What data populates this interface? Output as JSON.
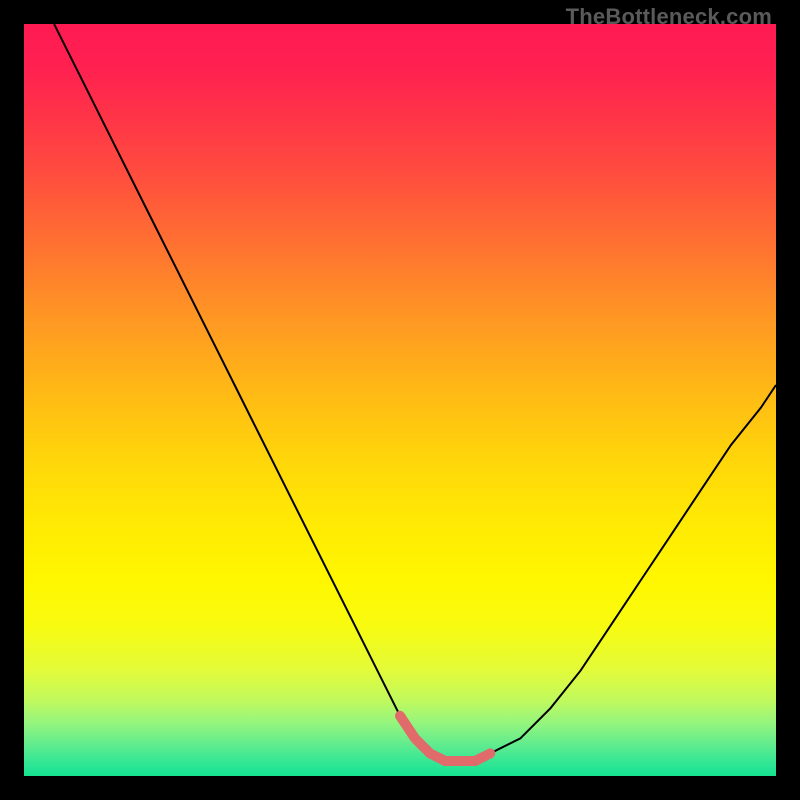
{
  "watermark": "TheBottleneck.com",
  "gradient": {
    "stops": [
      {
        "offset": 0.0,
        "color": "#ff1a52"
      },
      {
        "offset": 0.06,
        "color": "#ff2150"
      },
      {
        "offset": 0.12,
        "color": "#ff3348"
      },
      {
        "offset": 0.2,
        "color": "#ff4d3e"
      },
      {
        "offset": 0.3,
        "color": "#ff7430"
      },
      {
        "offset": 0.4,
        "color": "#ff9a22"
      },
      {
        "offset": 0.5,
        "color": "#ffbd14"
      },
      {
        "offset": 0.58,
        "color": "#ffd60a"
      },
      {
        "offset": 0.66,
        "color": "#ffe904"
      },
      {
        "offset": 0.74,
        "color": "#fff700"
      },
      {
        "offset": 0.8,
        "color": "#f8fb10"
      },
      {
        "offset": 0.86,
        "color": "#e2fb3a"
      },
      {
        "offset": 0.9,
        "color": "#c0f95e"
      },
      {
        "offset": 0.93,
        "color": "#94f57e"
      },
      {
        "offset": 0.96,
        "color": "#5deb8f"
      },
      {
        "offset": 0.985,
        "color": "#2de695"
      },
      {
        "offset": 1.0,
        "color": "#16e28f"
      }
    ]
  },
  "chart_data": {
    "type": "line",
    "title": "",
    "xlabel": "",
    "ylabel": "",
    "xlim": [
      0,
      100
    ],
    "ylim": [
      0,
      100
    ],
    "series": [
      {
        "name": "curve",
        "x": [
          4,
          8,
          12,
          16,
          20,
          24,
          28,
          32,
          36,
          40,
          44,
          48,
          50,
          52,
          54,
          56,
          58,
          60,
          62,
          66,
          70,
          74,
          78,
          82,
          86,
          90,
          94,
          98,
          100
        ],
        "y": [
          100,
          92,
          84,
          76,
          68,
          60,
          52,
          44,
          36,
          28,
          20,
          12,
          8,
          5,
          3,
          2,
          2,
          2,
          3,
          5,
          9,
          14,
          20,
          26,
          32,
          38,
          44,
          49,
          52
        ]
      }
    ],
    "highlight": {
      "color": "#e16a6a",
      "x_range": [
        50,
        62
      ],
      "y": 2
    }
  }
}
